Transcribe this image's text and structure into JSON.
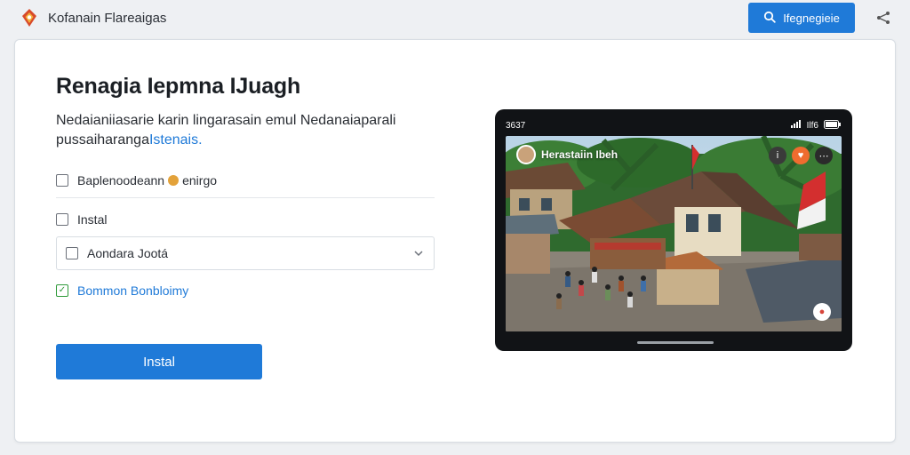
{
  "header": {
    "brand": "Kofanain Flareaigas",
    "search_button": "Ifegnegieie"
  },
  "card": {
    "title": "Renagia Iepmna IJuagh",
    "description": "Nedaianiiasarie karin lingarasain emul Nedanaiaparali pussaiharanga",
    "description_link": "Istenais.",
    "options": [
      {
        "label": "Baplenoodeann",
        "suffix": "enirgo",
        "checked": false
      },
      {
        "label": "Instal",
        "checked": false
      }
    ],
    "select": {
      "value": "Aondara Jootá"
    },
    "confirm": {
      "label": "Bommon Bonbloimy",
      "checked": true
    },
    "install_button": "Instal"
  },
  "tablet": {
    "status_time": "3637",
    "status_right": "Ilf6",
    "video_title": "Herastaiin Ibeh"
  },
  "colors": {
    "accent": "#1f7ad8",
    "check_green": "#2f9a3a"
  },
  "icons": [
    "lotus-logo-icon",
    "search-icon",
    "share-icon",
    "checkbox-icon",
    "chevron-down-icon"
  ]
}
